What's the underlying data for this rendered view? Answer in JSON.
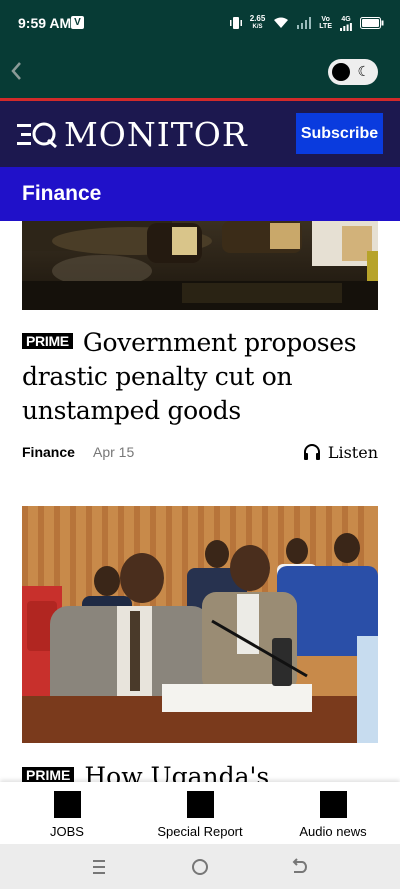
{
  "status_bar": {
    "time": "9:59 AM",
    "carrier_badge": "V",
    "net_speed": "2.65",
    "net_speed_unit": "K/S",
    "network_label_top": "Vo",
    "network_label_bottom": "LTE",
    "network_gen": "4G"
  },
  "toolbar": {
    "back_icon": "chevron-left-icon",
    "mode_icon": "moon-icon"
  },
  "header": {
    "logo_text": "MONITOR",
    "subscribe_label": "Subscribe",
    "colors": {
      "header_bg": "#1c184f",
      "accent_red": "#d22a2a",
      "subscribe_bg": "#0a3bde"
    }
  },
  "section": {
    "title": "Finance",
    "color": "#2011c9"
  },
  "articles": [
    {
      "badge": "PRIME",
      "title": "Government proposes drastic penalty cut on unstamped goods",
      "section": "Finance",
      "date": "Apr 15",
      "listen_label": "Listen"
    },
    {
      "badge": "PRIME",
      "title": "How Uganda's"
    }
  ],
  "bottom_nav": [
    {
      "label": "JOBS"
    },
    {
      "label": "Special Report"
    },
    {
      "label": "Audio news"
    }
  ],
  "system_nav": {
    "recents_icon": "menu-icon",
    "home_icon": "home-circle-icon",
    "back_icon": "back-arrow-icon"
  }
}
